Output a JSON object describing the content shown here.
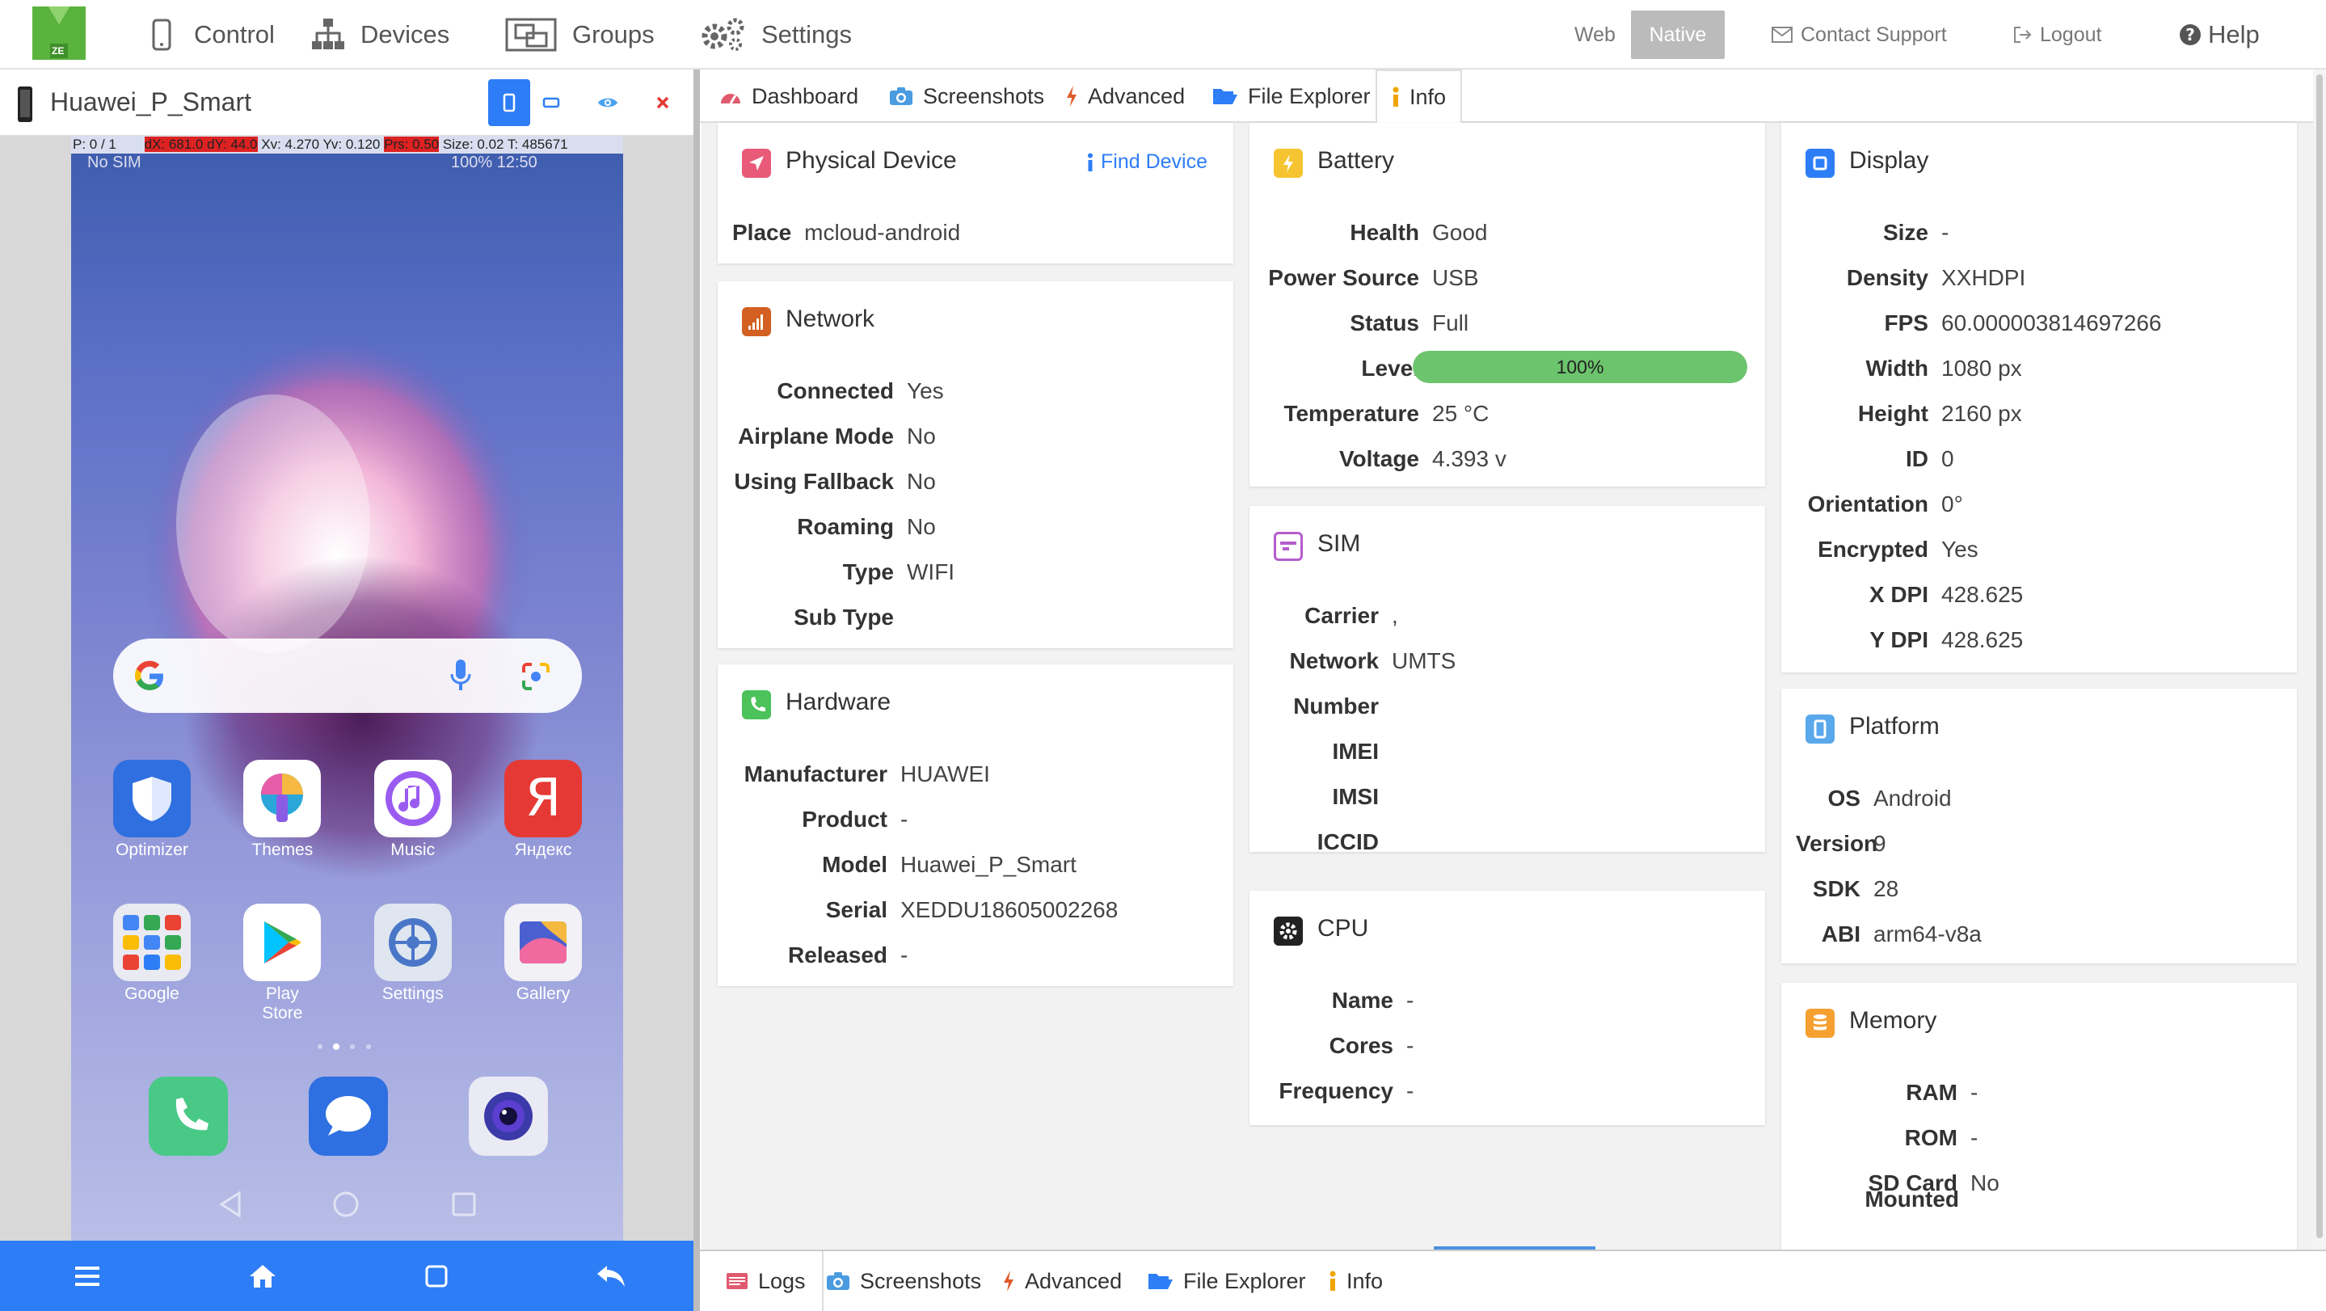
{
  "nav": {
    "logo_text": "ZE",
    "items": [
      {
        "label": "Control",
        "icon": "phone-icon"
      },
      {
        "label": "Devices",
        "icon": "sitemap-icon"
      },
      {
        "label": "Groups",
        "icon": "object-group-icon"
      },
      {
        "label": "Settings",
        "icon": "gears-icon"
      }
    ],
    "web_label": "Web",
    "native_label": "Native",
    "contact_label": "Contact Support",
    "logout_label": "Logout",
    "help_label": "Help"
  },
  "device": {
    "name": "Huawei_P_Smart",
    "debug": {
      "p": "P: 0 / 1",
      "dx": "dX: 681.0 dY: 44.0",
      "xv": "Xv: 4.270 Yv: 0.120",
      "prs": "Prs: 0.50",
      "size": "Size: 0.02",
      "t": "T: 485671"
    },
    "status_left": "No SIM",
    "status_right": "100%  12:50",
    "apps_row1": [
      {
        "label": "Optimizer",
        "color": "#2f6fe0"
      },
      {
        "label": "Themes",
        "color": "#2aa7d8"
      },
      {
        "label": "Music",
        "color": "#9a5cf0"
      },
      {
        "label": "Яндекс",
        "color": "#e53935"
      }
    ],
    "apps_row2": [
      {
        "label": "Google",
        "color": "#e9eaf2"
      },
      {
        "label": "Play Store",
        "color": "#ffffff"
      },
      {
        "label": "Settings",
        "color": "#dfe6ef"
      },
      {
        "label": "Gallery",
        "color": "#f1f1f6"
      }
    ],
    "dock": [
      {
        "label": "Phone",
        "color": "#48c986"
      },
      {
        "label": "Messages",
        "color": "#2e6fe2"
      },
      {
        "label": "Camera",
        "color": "#eaeaf4"
      }
    ]
  },
  "tabs": [
    {
      "label": "Dashboard",
      "icon": "dashboard-icon"
    },
    {
      "label": "Screenshots",
      "icon": "camera-icon"
    },
    {
      "label": "Advanced",
      "icon": "bolt-icon"
    },
    {
      "label": "File Explorer",
      "icon": "folder-open-icon"
    },
    {
      "label": "Info",
      "icon": "info-icon"
    }
  ],
  "cards": {
    "physical": {
      "title": "Physical Device",
      "find_label": "Find Device",
      "rows": [
        {
          "k": "Place",
          "v": "mcloud-android"
        }
      ]
    },
    "network": {
      "title": "Network",
      "rows": [
        {
          "k": "Connected",
          "v": "Yes"
        },
        {
          "k": "Airplane Mode",
          "v": "No"
        },
        {
          "k": "Using Fallback",
          "v": "No"
        },
        {
          "k": "Roaming",
          "v": "No"
        },
        {
          "k": "Type",
          "v": "WIFI"
        },
        {
          "k": "Sub Type",
          "v": ""
        }
      ]
    },
    "hardware": {
      "title": "Hardware",
      "rows": [
        {
          "k": "Manufacturer",
          "v": "HUAWEI"
        },
        {
          "k": "Product",
          "v": "-"
        },
        {
          "k": "Model",
          "v": "Huawei_P_Smart"
        },
        {
          "k": "Serial",
          "v": "XEDDU18605002268"
        },
        {
          "k": "Released",
          "v": "-"
        }
      ]
    },
    "battery": {
      "title": "Battery",
      "level": 1.0,
      "level_label": "100%",
      "rows": [
        {
          "k": "Health",
          "v": "Good"
        },
        {
          "k": "Power Source",
          "v": "USB"
        },
        {
          "k": "Status",
          "v": "Full"
        },
        {
          "k": "Level",
          "v": ""
        },
        {
          "k": "Temperature",
          "v": "25 °C"
        },
        {
          "k": "Voltage",
          "v": "4.393 v"
        }
      ]
    },
    "sim": {
      "title": "SIM",
      "rows": [
        {
          "k": "Carrier",
          "v": ","
        },
        {
          "k": "Network",
          "v": "UMTS"
        },
        {
          "k": "Number",
          "v": ""
        },
        {
          "k": "IMEI",
          "v": ""
        },
        {
          "k": "IMSI",
          "v": ""
        },
        {
          "k": "ICCID",
          "v": ""
        }
      ]
    },
    "cpu": {
      "title": "CPU",
      "rows": [
        {
          "k": "Name",
          "v": "-"
        },
        {
          "k": "Cores",
          "v": "-"
        },
        {
          "k": "Frequency",
          "v": "-"
        }
      ]
    },
    "display": {
      "title": "Display",
      "rows": [
        {
          "k": "Size",
          "v": "-"
        },
        {
          "k": "Density",
          "v": "XXHDPI"
        },
        {
          "k": "FPS",
          "v": "60.000003814697266"
        },
        {
          "k": "Width",
          "v": "1080 px"
        },
        {
          "k": "Height",
          "v": "2160 px"
        },
        {
          "k": "ID",
          "v": "0"
        },
        {
          "k": "Orientation",
          "v": "0°"
        },
        {
          "k": "Encrypted",
          "v": "Yes"
        },
        {
          "k": "X DPI",
          "v": "428.625"
        },
        {
          "k": "Y DPI",
          "v": "428.625"
        }
      ]
    },
    "platform": {
      "title": "Platform",
      "rows": [
        {
          "k": "OS",
          "v": "Android"
        },
        {
          "k": "Version",
          "v": "9"
        },
        {
          "k": "SDK",
          "v": "28"
        },
        {
          "k": "ABI",
          "v": "arm64-v8a"
        }
      ]
    },
    "memory": {
      "title": "Memory",
      "rows": [
        {
          "k": "RAM",
          "v": "-"
        },
        {
          "k": "ROM",
          "v": "-"
        },
        {
          "k": "SD Card",
          "v": "No"
        }
      ],
      "sd_extra": "Mounted"
    }
  },
  "bottom_tabs": [
    {
      "label": "Logs",
      "icon": "logs-icon"
    },
    {
      "label": "Screenshots",
      "icon": "camera-icon"
    },
    {
      "label": "Advanced",
      "icon": "bolt-icon"
    },
    {
      "label": "File Explorer",
      "icon": "folder-open-icon"
    },
    {
      "label": "Info",
      "icon": "info-icon"
    }
  ],
  "colors": {
    "accent": "#2d7df6",
    "battery": "#6cc46c",
    "native_bg": "#bbbbbb",
    "logo": "#59b33d"
  }
}
